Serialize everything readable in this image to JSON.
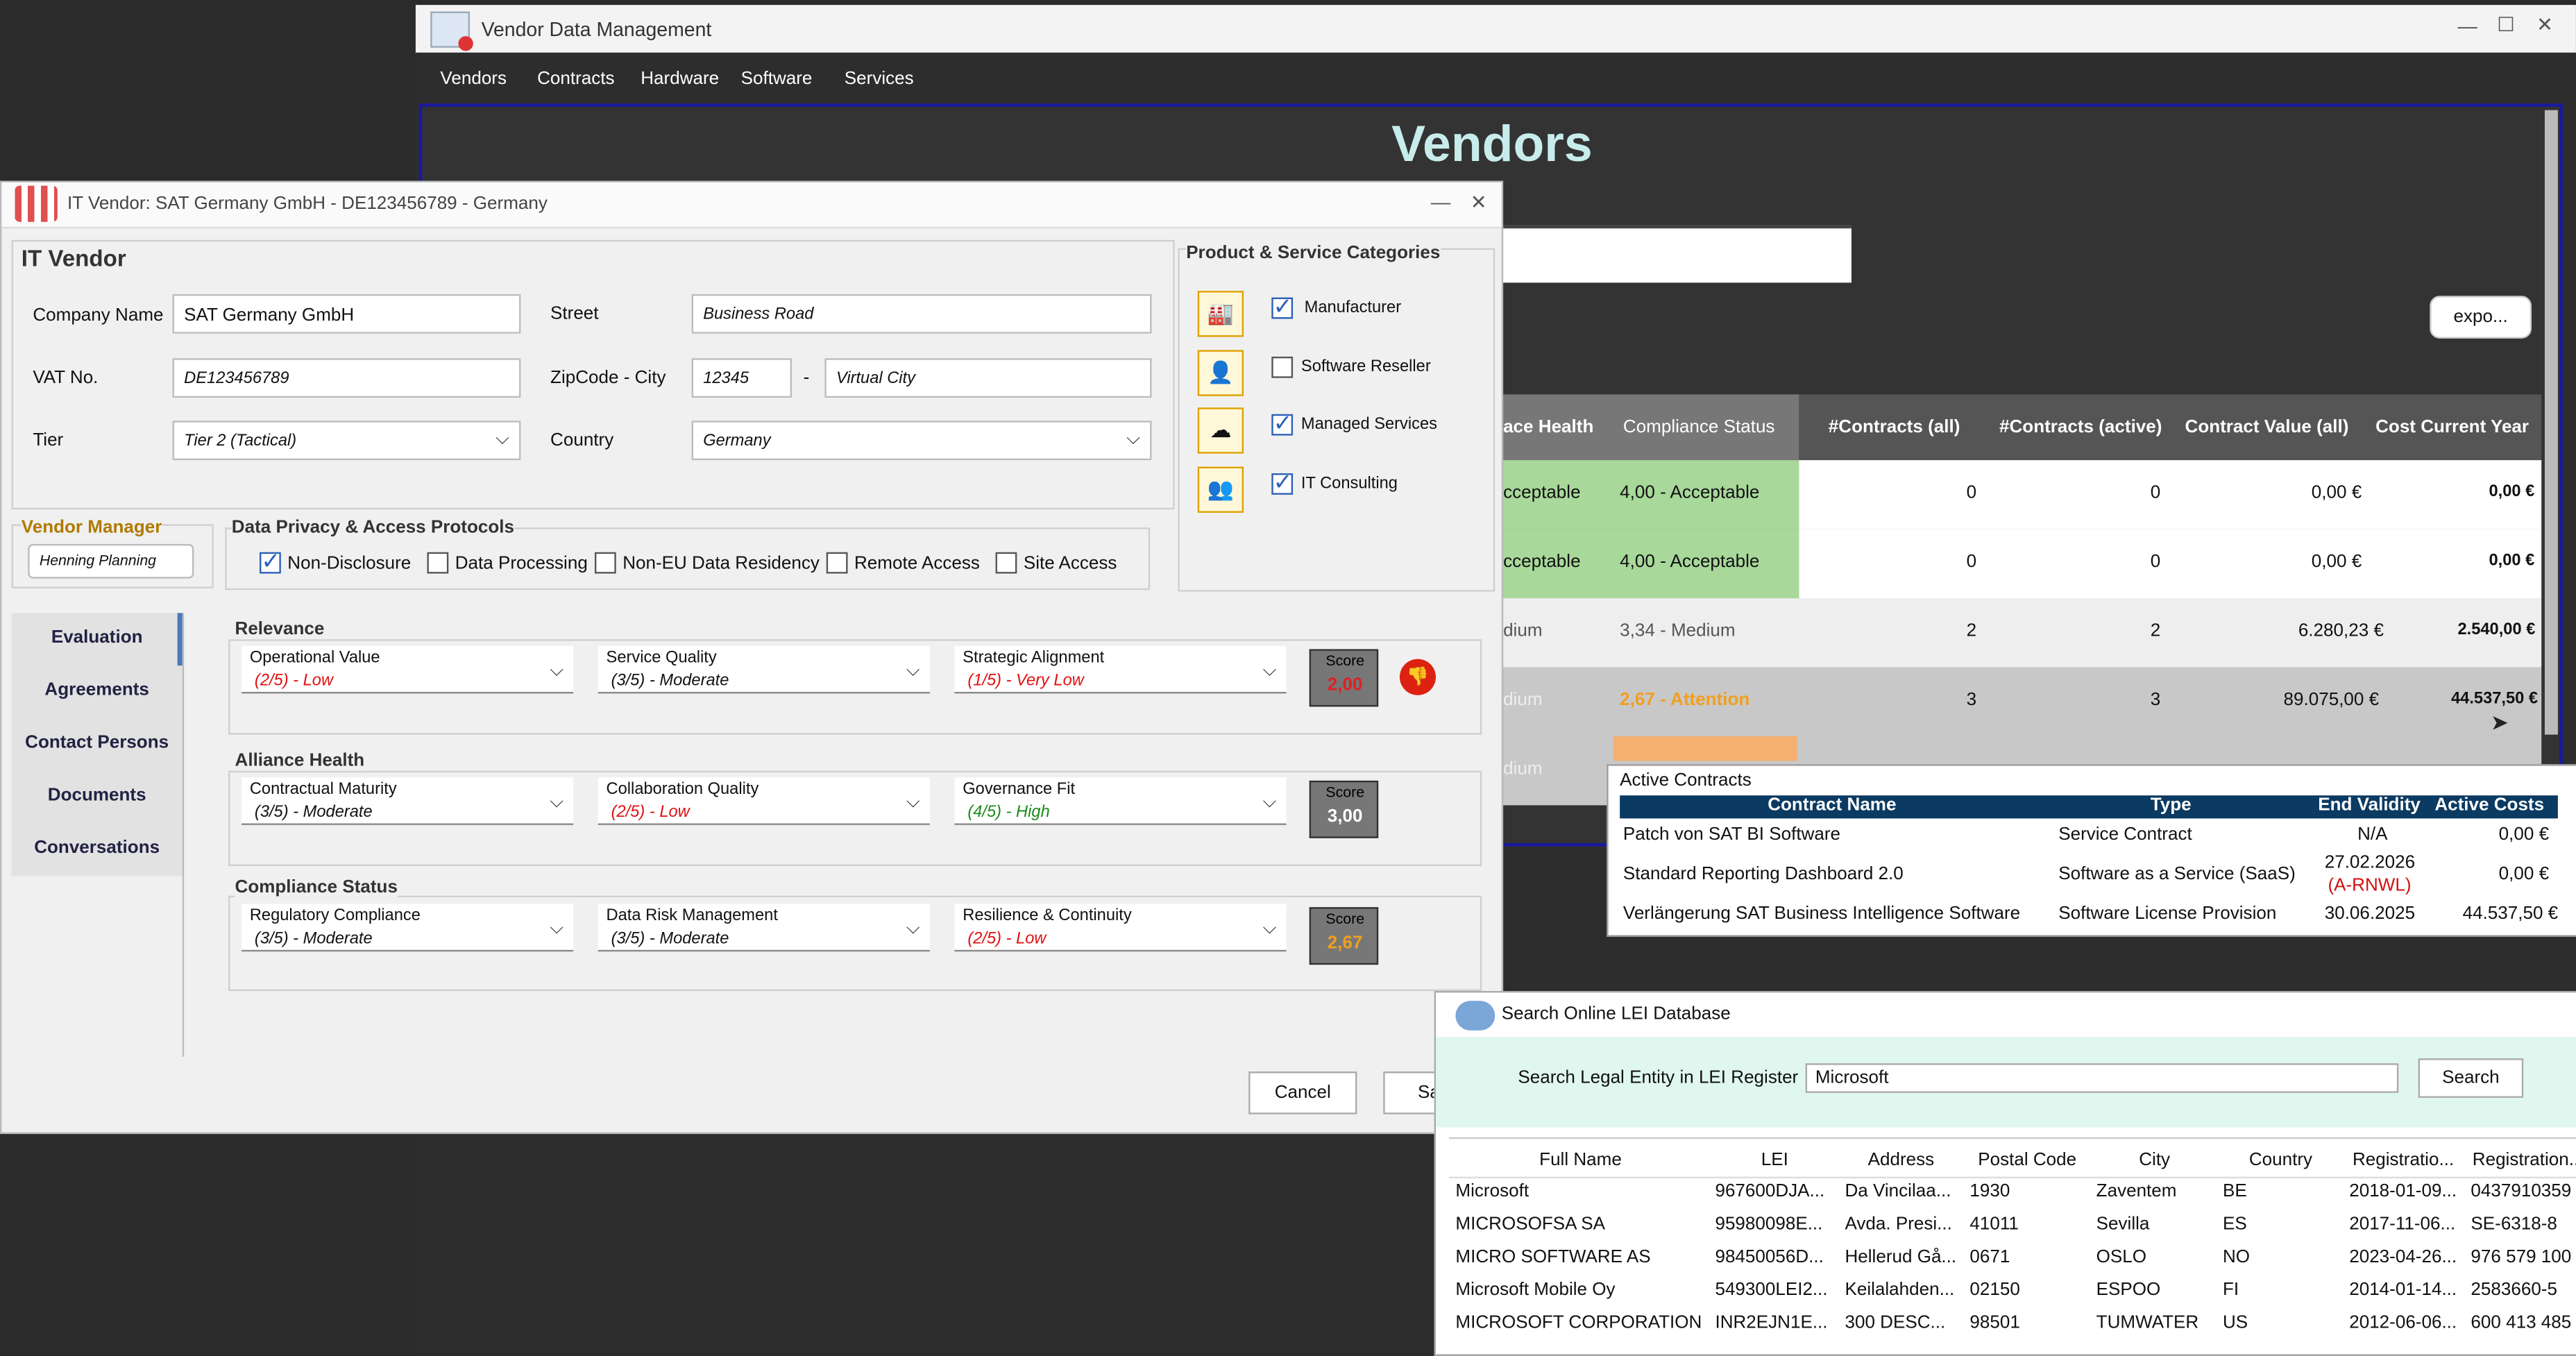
{
  "main_window": {
    "title": "Vendor Data Management",
    "menu": [
      "Vendors",
      "Contracts",
      "Hardware",
      "Software",
      "Services"
    ],
    "heading": "Vendors",
    "export_label": "expo...",
    "columns": [
      "ace Health",
      "Compliance Status",
      "#Contracts (all)",
      "#Contracts (active)",
      "Contract Value (all)",
      "Cost Current Year"
    ],
    "rows": [
      {
        "health": "cceptable",
        "compliance": "4,00 - Acceptable",
        "contracts_all": "0",
        "contracts_active": "0",
        "value_all": "0,00 €",
        "cost_year": "0,00 €"
      },
      {
        "health": "cceptable",
        "compliance": "4,00 - Acceptable",
        "contracts_all": "0",
        "contracts_active": "0",
        "value_all": "0,00 €",
        "cost_year": "0,00 €"
      },
      {
        "health": "dium",
        "compliance": "3,34 - Medium",
        "contracts_all": "2",
        "contracts_active": "2",
        "value_all": "6.280,23 €",
        "cost_year": "2.540,00 €"
      },
      {
        "health": "dium",
        "compliance": "2,67 - Attention",
        "contracts_all": "3",
        "contracts_active": "3",
        "value_all": "89.075,00 €",
        "cost_year": "44.537,50 €"
      },
      {
        "health": "dium"
      }
    ]
  },
  "vendor_dialog": {
    "title": "IT Vendor: SAT Germany GmbH  - DE123456789  - Germany",
    "section_title": "IT Vendor",
    "company_name_label": "Company Name",
    "company_name": "SAT Germany GmbH",
    "vat_label": "VAT No.",
    "vat": "DE123456789",
    "tier_label": "Tier",
    "tier": "Tier 2 (Tactical)",
    "street_label": "Street",
    "street": "Business Road",
    "zip_city_label": "ZipCode - City",
    "zip": "12345",
    "zip_sep": "-",
    "city": "Virtual City",
    "country_label": "Country",
    "country": "Germany",
    "categories_title": "Product & Service Categories",
    "categories": [
      {
        "label": "Manufacturer",
        "checked": true,
        "icon": "factory-icon"
      },
      {
        "label": "Software Reseller",
        "checked": false,
        "icon": "reseller-person-icon"
      },
      {
        "label": "Managed Services",
        "checked": true,
        "icon": "cloud-services-icon"
      },
      {
        "label": "IT Consulting",
        "checked": true,
        "icon": "consulting-people-icon"
      }
    ],
    "vendor_manager_title": "Vendor Manager",
    "vendor_manager": "Henning Planning",
    "privacy_title": "Data Privacy & Access Protocols",
    "privacy": [
      {
        "label": "Non-Disclosure",
        "checked": true
      },
      {
        "label": "Data Processing",
        "checked": false
      },
      {
        "label": "Non-EU Data Residency",
        "checked": false
      },
      {
        "label": "Remote Access",
        "checked": false
      },
      {
        "label": "Site Access",
        "checked": false
      }
    ],
    "nav": [
      "Evaluation",
      "Agreements",
      "Contact Persons",
      "Documents",
      "Conversations"
    ],
    "score_label": "Score",
    "relevance": {
      "title": "Relevance",
      "items": [
        {
          "label": "Operational Value",
          "value": "(2/5) - Low",
          "color": "#e01010"
        },
        {
          "label": "Service Quality",
          "value": "(3/5) - Moderate",
          "color": "#111111"
        },
        {
          "label": "Strategic Alignment",
          "value": "(1/5) - Very Low",
          "color": "#e01010"
        }
      ],
      "score": "2,00",
      "score_color": "#e02020"
    },
    "alliance": {
      "title": "Alliance Health",
      "items": [
        {
          "label": "Contractual Maturity",
          "value": "(3/5) - Moderate",
          "color": "#111111"
        },
        {
          "label": "Collaboration Quality",
          "value": "(2/5) - Low",
          "color": "#e01010"
        },
        {
          "label": "Governance Fit",
          "value": "(4/5) - High",
          "color": "#1a8a1a"
        }
      ],
      "score": "3,00",
      "score_color": "#ffffff"
    },
    "compliance": {
      "title": "Compliance Status",
      "items": [
        {
          "label": "Regulatory Compliance",
          "value": "(3/5) - Moderate",
          "color": "#111111"
        },
        {
          "label": "Data Risk Management",
          "value": "(3/5) - Moderate",
          "color": "#111111"
        },
        {
          "label": "Resilience & Continuity",
          "value": "(2/5) - Low",
          "color": "#e01010"
        }
      ],
      "score": "2,67",
      "score_color": "#f0a020"
    },
    "cancel_label": "Cancel",
    "save_label": "Sa"
  },
  "contracts_popup": {
    "title": "Active Contracts",
    "columns": [
      "Contract Name",
      "Type",
      "End Validity",
      "Active Costs"
    ],
    "rows": [
      {
        "name": "Patch von SAT BI Software",
        "type": "Service Contract",
        "end": "N/A",
        "end_note": "",
        "cost": "0,00 €"
      },
      {
        "name": "Standard Reporting Dashboard 2.0",
        "type": "Software as a Service (SaaS)",
        "end": "27.02.2026",
        "end_note": "(A-RNWL)",
        "cost": "0,00 €"
      },
      {
        "name": "Verlängerung SAT Business Intelligence Software",
        "type": "Software License Provision",
        "end": "30.06.2025",
        "end_note": "",
        "cost": "44.537,50 €"
      }
    ]
  },
  "lei_window": {
    "title": "Search Online LEI Database",
    "search_label": "Search Legal Entity in LEI Register",
    "search_value": "Microsoft",
    "search_button": "Search",
    "columns": [
      "Full Name",
      "LEI",
      "Address",
      "Postal Code",
      "City",
      "Country",
      "Registratio...",
      "Registration..."
    ],
    "rows": [
      [
        "Microsoft",
        "967600DJA...",
        "Da Vincilaa...",
        "1930",
        "Zaventem",
        "BE",
        "2018-01-09...",
        "0437910359"
      ],
      [
        "MICROSOFSA SA",
        "95980098E...",
        "Avda. Presi...",
        "41011",
        "Sevilla",
        "ES",
        "2017-11-06...",
        "SE-6318-8"
      ],
      [
        "MICRO SOFTWARE AS",
        "98450056D...",
        "Hellerud Gå...",
        "0671",
        "OSLO",
        "NO",
        "2023-04-26...",
        "976 579 100"
      ],
      [
        "Microsoft Mobile Oy",
        "549300LEI2...",
        "Keilalahden...",
        "02150",
        "ESPOO",
        "FI",
        "2014-01-14...",
        "2583660-5"
      ],
      [
        "MICROSOFT CORPORATION",
        "INR2EJN1E...",
        "300 DESC...",
        "98501",
        "TUMWATER",
        "US",
        "2012-06-06...",
        "600 413 485"
      ]
    ]
  }
}
